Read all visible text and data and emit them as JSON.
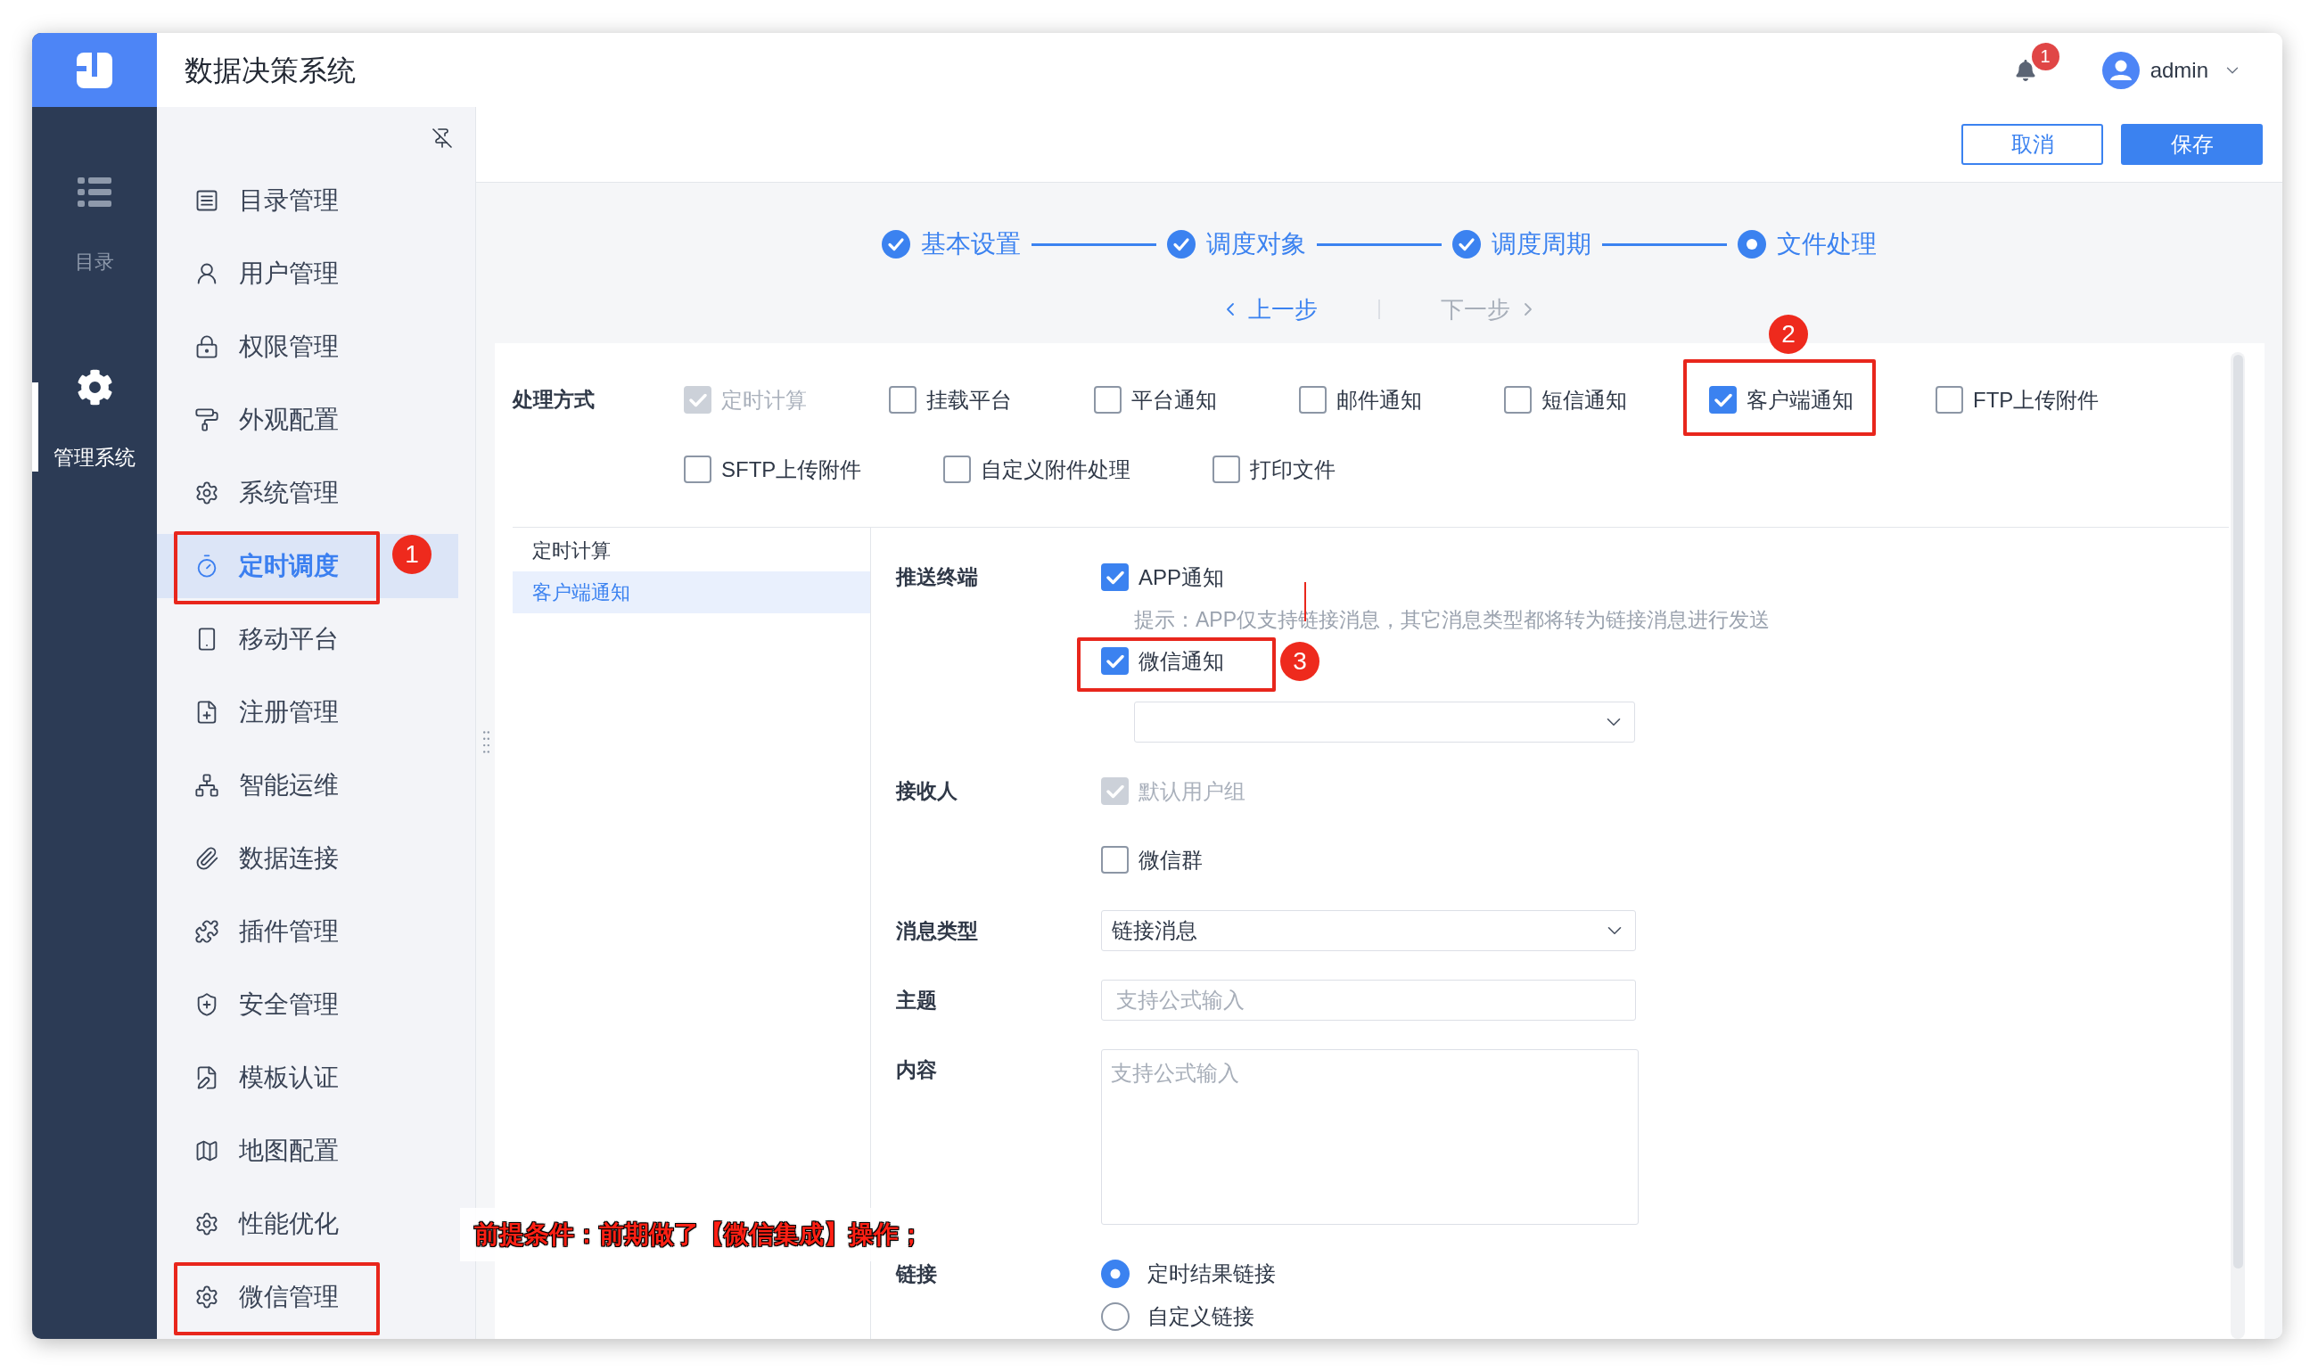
{
  "header": {
    "title": "数据决策系统",
    "notification_count": "1",
    "user_name": "admin"
  },
  "rail": [
    {
      "label": "目录",
      "selected": false
    },
    {
      "label": "管理系统",
      "selected": true
    }
  ],
  "sidebar": {
    "items": [
      {
        "label": "目录管理",
        "selected": false,
        "framed": false
      },
      {
        "label": "用户管理",
        "selected": false,
        "framed": false
      },
      {
        "label": "权限管理",
        "selected": false,
        "framed": false
      },
      {
        "label": "外观配置",
        "selected": false,
        "framed": false
      },
      {
        "label": "系统管理",
        "selected": false,
        "framed": false
      },
      {
        "label": "定时调度",
        "selected": true,
        "framed": true,
        "marker": "1"
      },
      {
        "label": "移动平台",
        "selected": false,
        "framed": false
      },
      {
        "label": "注册管理",
        "selected": false,
        "framed": false
      },
      {
        "label": "智能运维",
        "selected": false,
        "framed": false
      },
      {
        "label": "数据连接",
        "selected": false,
        "framed": false
      },
      {
        "label": "插件管理",
        "selected": false,
        "framed": false
      },
      {
        "label": "安全管理",
        "selected": false,
        "framed": false
      },
      {
        "label": "模板认证",
        "selected": false,
        "framed": false
      },
      {
        "label": "地图配置",
        "selected": false,
        "framed": false
      },
      {
        "label": "性能优化",
        "selected": false,
        "framed": false
      },
      {
        "label": "微信管理",
        "selected": false,
        "framed": true
      }
    ]
  },
  "toolbar": {
    "buttons": [
      {
        "label": "取消",
        "kind": "outline"
      },
      {
        "label": "保存",
        "kind": "primary"
      }
    ]
  },
  "steps": [
    {
      "label": "基本设置",
      "done": true
    },
    {
      "label": "调度对象",
      "done": true
    },
    {
      "label": "调度周期",
      "done": true
    },
    {
      "label": "文件处理",
      "done": false
    }
  ],
  "step_nav": [
    {
      "label": "上一步",
      "disabled": false
    },
    {
      "label": "下一步",
      "disabled": true
    }
  ],
  "processing": {
    "label": "处理方式",
    "options": [
      {
        "label": "定时计算",
        "checked": true,
        "disabled": true,
        "framed": false
      },
      {
        "label": "挂载平台",
        "checked": false,
        "disabled": false,
        "framed": false
      },
      {
        "label": "平台通知",
        "checked": false,
        "disabled": false,
        "framed": false
      },
      {
        "label": "邮件通知",
        "checked": false,
        "disabled": false,
        "framed": false
      },
      {
        "label": "短信通知",
        "checked": false,
        "disabled": false,
        "framed": false
      },
      {
        "label": "客户端通知",
        "checked": true,
        "disabled": false,
        "framed": true,
        "marker": "2"
      },
      {
        "label": "FTP上传附件",
        "checked": false,
        "disabled": false,
        "framed": false
      },
      {
        "label": "SFTP上传附件",
        "checked": false,
        "disabled": false,
        "framed": false
      },
      {
        "label": "自定义附件处理",
        "checked": false,
        "disabled": false,
        "framed": false
      },
      {
        "label": "打印文件",
        "checked": false,
        "disabled": false,
        "framed": false
      }
    ]
  },
  "subnav": [
    {
      "label": "定时计算",
      "selected": false
    },
    {
      "label": "客户端通知",
      "selected": true
    }
  ],
  "form": {
    "push_terminal": {
      "label": "推送终端",
      "options": [
        {
          "label": "APP通知",
          "checked": true,
          "disabled": false,
          "framed": false,
          "hint": "提示：APP仅支持链接消息，其它消息类型都将转为链接消息进行发送"
        },
        {
          "label": "微信通知",
          "checked": true,
          "disabled": false,
          "framed": true,
          "marker": "3"
        }
      ]
    },
    "recipients": {
      "label": "接收人",
      "options": [
        {
          "label": "默认用户组",
          "checked": true,
          "disabled": true
        },
        {
          "label": "微信群",
          "checked": false,
          "disabled": false
        }
      ]
    },
    "message_type": {
      "label": "消息类型",
      "value": "链接消息"
    },
    "subject": {
      "label": "主题",
      "placeholder": "支持公式输入"
    },
    "content": {
      "label": "内容",
      "placeholder": "支持公式输入"
    },
    "link": {
      "label": "链接",
      "options": [
        {
          "label": "定时结果链接",
          "selected": true
        },
        {
          "label": "自定义链接",
          "selected": false
        }
      ]
    }
  },
  "annotation_note": "前提条件：前期做了【微信集成】操作；"
}
